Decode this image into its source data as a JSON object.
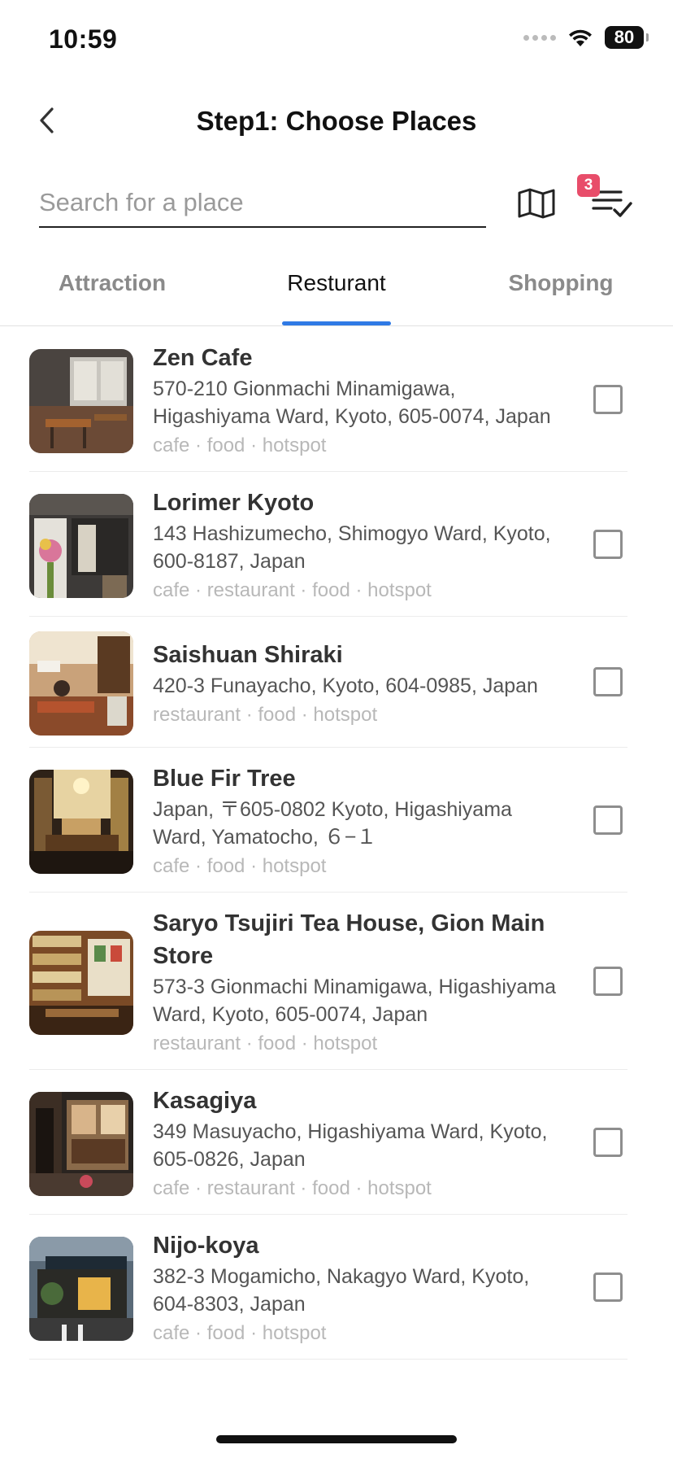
{
  "status_bar": {
    "time": "10:59",
    "battery": "80",
    "icons": [
      "signal-icon",
      "wifi-icon",
      "battery-icon"
    ]
  },
  "header": {
    "title": "Step1: Choose Places",
    "back_icon": "chevron-left-icon"
  },
  "search": {
    "placeholder": "Search for a place",
    "value": ""
  },
  "toolbar": {
    "map_icon": "map-icon",
    "selected_list_icon": "checklist-icon",
    "selected_count": "3"
  },
  "colors": {
    "accent": "#2f7ae5",
    "badge": "#e84d6a"
  },
  "tabs": [
    {
      "label": "Attraction",
      "active": false
    },
    {
      "label": "Resturant",
      "active": true
    },
    {
      "label": "Shopping",
      "active": false
    }
  ],
  "places": [
    {
      "name": "Zen Cafe",
      "address": "570-210 Gionmachi Minamigawa, Higashiyama Ward, Kyoto, 605-0074, Japan",
      "tags": "cafe · food · hotspot",
      "checked": false
    },
    {
      "name": "Lorimer Kyoto",
      "address": "143 Hashizumecho, Shimogyo Ward, Kyoto, 600-8187, Japan",
      "tags": "cafe · restaurant · food · hotspot",
      "checked": false
    },
    {
      "name": "Saishuan Shiraki",
      "address": "420-3 Funayacho, Kyoto, 604-0985, Japan",
      "tags": "restaurant · food · hotspot",
      "checked": false
    },
    {
      "name": "Blue Fir Tree",
      "address": "Japan, 〒605-0802 Kyoto, Higashiyama Ward, Yamatocho, ６−１",
      "tags": "cafe · food · hotspot",
      "checked": false
    },
    {
      "name": "Saryo Tsujiri Tea House, Gion Main Store",
      "address": "573-3 Gionmachi Minamigawa, Higashiyama Ward, Kyoto, 605-0074, Japan",
      "tags": "restaurant · food · hotspot",
      "checked": false
    },
    {
      "name": "Kasagiya",
      "address": "349 Masuyacho, Higashiyama Ward, Kyoto, 605-0826, Japan",
      "tags": "cafe · restaurant · food · hotspot",
      "checked": false
    },
    {
      "name": "Nijo-koya",
      "address": "382-3 Mogamicho, Nakagyo Ward, Kyoto, 604-8303, Japan",
      "tags": "cafe · food · hotspot",
      "checked": false
    }
  ]
}
